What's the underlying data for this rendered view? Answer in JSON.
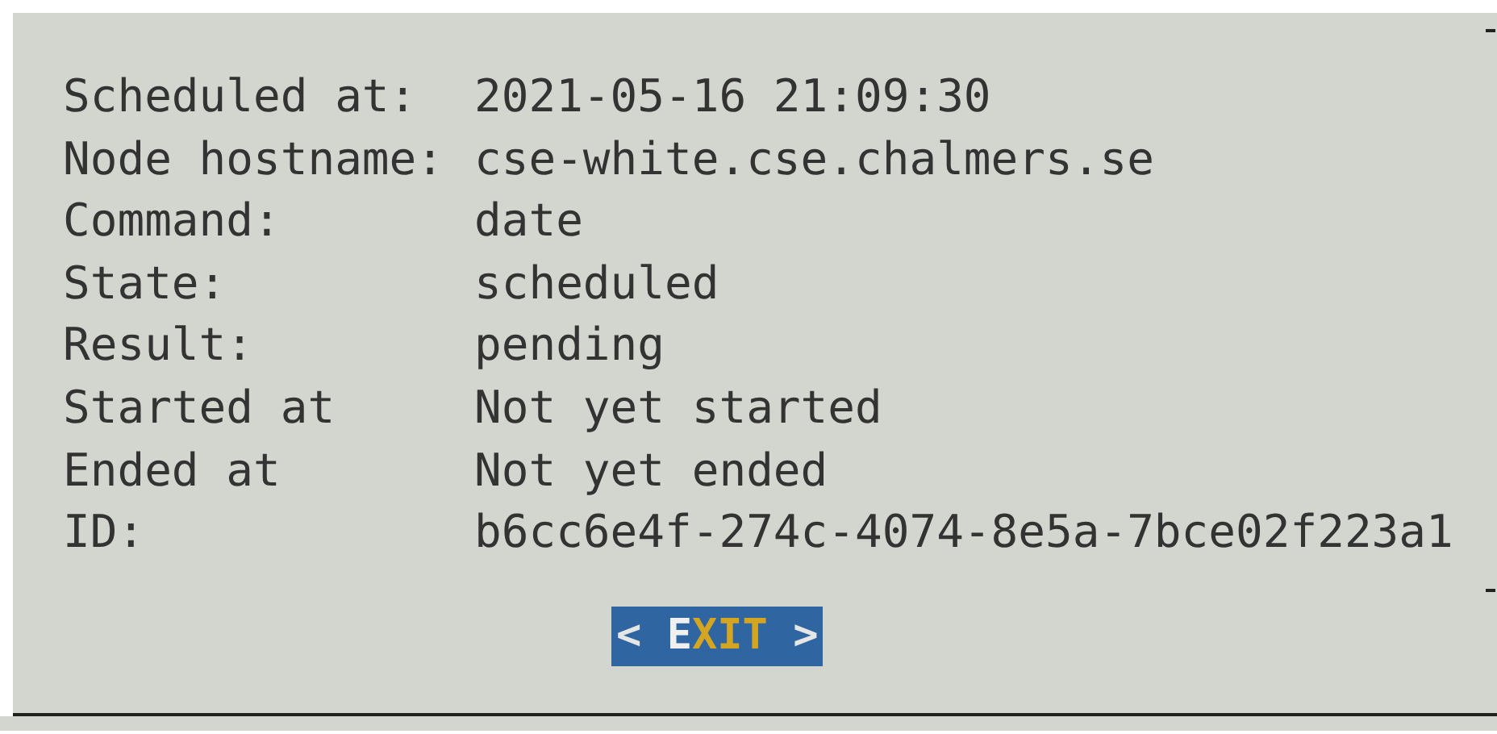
{
  "fields": [
    {
      "label": "Scheduled at:",
      "value": "2021-05-16 21:09:30"
    },
    {
      "label": "Node hostname:",
      "value": "cse-white.cse.chalmers.se"
    },
    {
      "label": "Command:",
      "value": "date"
    },
    {
      "label": "State:",
      "value": "scheduled"
    },
    {
      "label": "Result:",
      "value": "pending"
    },
    {
      "label": "Started at",
      "value": "Not yet started"
    },
    {
      "label": "Ended at",
      "value": "Not yet ended"
    },
    {
      "label": "ID:",
      "value": "b6cc6e4f-274c-4074-8e5a-7bce02f223a1"
    }
  ],
  "button": {
    "left": "<",
    "label": "EXIT",
    "right": ">",
    "selected": true
  }
}
